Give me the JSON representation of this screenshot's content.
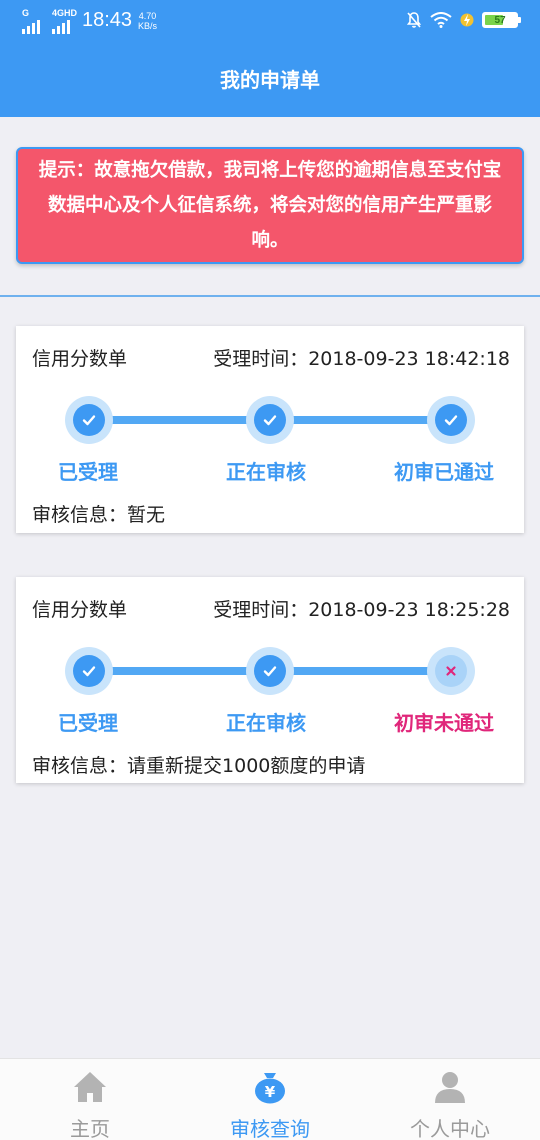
{
  "status_bar": {
    "network_1": "G",
    "network_2": "4GHD",
    "time": "18:43",
    "speed_value": "4.70",
    "speed_unit": "KB/s",
    "battery": "57"
  },
  "header": {
    "title": "我的申请单"
  },
  "notice": {
    "text": "提示：故意拖欠借款，我司将上传您的逾期信息至支付宝数据中心及个人征信系统，将会对您的信用产生严重影响。"
  },
  "applications": [
    {
      "type": "信用分数单",
      "time_label": "受理时间：",
      "time": "2018-09-23 18:42:18",
      "steps": [
        {
          "label": "已受理",
          "status": "done"
        },
        {
          "label": "正在审核",
          "status": "done"
        },
        {
          "label": "初审已通过",
          "status": "done"
        }
      ],
      "info_label": "审核信息：",
      "info": "暂无"
    },
    {
      "type": "信用分数单",
      "time_label": "受理时间：",
      "time": "2018-09-23 18:25:28",
      "steps": [
        {
          "label": "已受理",
          "status": "done"
        },
        {
          "label": "正在审核",
          "status": "done"
        },
        {
          "label": "初审未通过",
          "status": "failed"
        }
      ],
      "info_label": "审核信息：",
      "info": "请重新提交1000额度的申请"
    }
  ],
  "tabbar": {
    "items": [
      {
        "label": "主页",
        "icon": "home-icon",
        "active": false
      },
      {
        "label": "审核查询",
        "icon": "money-bag-icon",
        "active": true
      },
      {
        "label": "个人中心",
        "icon": "user-icon",
        "active": false
      }
    ]
  },
  "colors": {
    "primary": "#3d99f3",
    "notice_bg": "#f4566b",
    "fail": "#e0267a",
    "inactive": "#9a9a9a"
  }
}
